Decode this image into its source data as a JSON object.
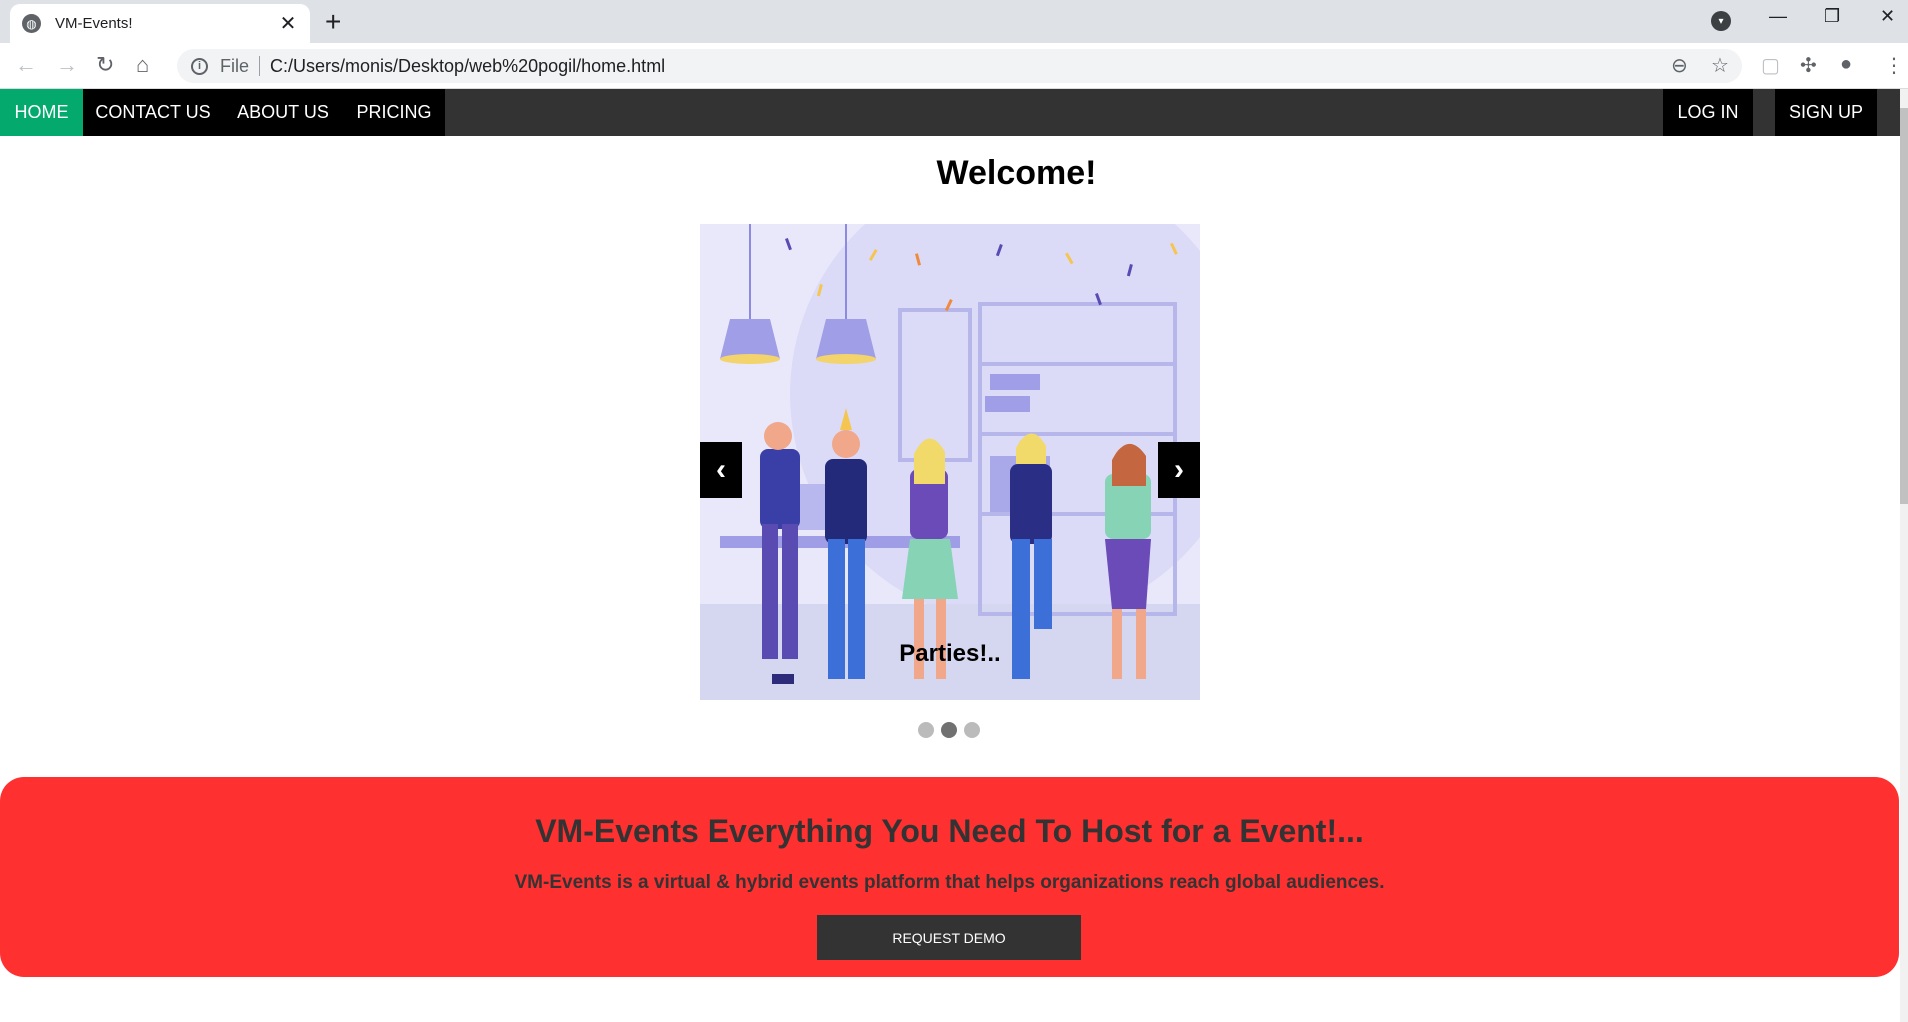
{
  "browser": {
    "tab_title": "VM-Events!",
    "omnibox_scheme": "File",
    "omnibox_url": "C:/Users/monis/Desktop/web%20pogil/home.html"
  },
  "icons": {
    "back": "arrow-left-icon",
    "forward": "arrow-right-icon",
    "reload": "reload-icon",
    "home": "home-icon",
    "zoom": "zoom-out-icon",
    "star": "star-icon",
    "extensions": "puzzle-icon",
    "profile": "profile-icon",
    "menu": "kebab-menu-icon"
  },
  "nav": {
    "home": "HOME",
    "contact": "CONTACT US",
    "about": "ABOUT US",
    "pricing": "PRICING",
    "login": "LOG IN",
    "signup": "SIGN UP"
  },
  "hero": {
    "welcome": "Welcome!",
    "caption": "Parties!..",
    "prev": "‹",
    "next": "›",
    "dots": 3,
    "active_dot": 2
  },
  "banner": {
    "title": "VM-Events Everything You Need To Host for a Event!...",
    "subtitle": "VM-Events is a virtual & hybrid events platform that helps organizations reach global audiences.",
    "button": "REQUEST DEMO"
  },
  "colors": {
    "nav_bg": "#333333",
    "nav_active": "#04aa6d",
    "banner_bg": "#ff3030"
  }
}
